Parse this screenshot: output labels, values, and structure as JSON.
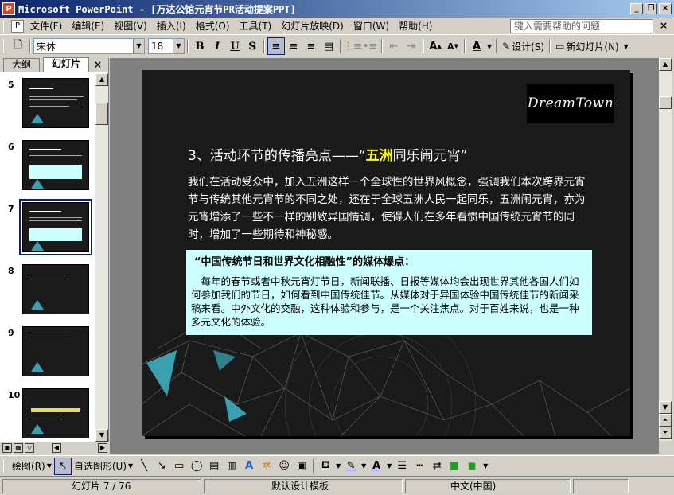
{
  "window": {
    "title": "Microsoft PowerPoint - [万达公馆元宵节PR活动提案PPT]",
    "app_icon": "P"
  },
  "menu": {
    "items": [
      "文件(F)",
      "编辑(E)",
      "视图(V)",
      "插入(I)",
      "格式(O)",
      "工具(T)",
      "幻灯片放映(D)",
      "窗口(W)",
      "帮助(H)"
    ],
    "help_placeholder": "键入需要帮助的问题"
  },
  "toolbar": {
    "font": "宋体",
    "size": "18",
    "bold": "B",
    "italic": "I",
    "underline": "U",
    "shadow": "S",
    "design_label": "设计(S)",
    "new_slide_label": "新幻灯片(N)"
  },
  "outline_panel": {
    "tabs": [
      "大纲",
      "幻灯片"
    ],
    "active_tab": "幻灯片",
    "thumbnails": [
      {
        "num": "5"
      },
      {
        "num": "6"
      },
      {
        "num": "7",
        "selected": true
      },
      {
        "num": "8"
      },
      {
        "num": "9"
      },
      {
        "num": "10"
      }
    ]
  },
  "slide": {
    "logo_text": "DreamTown",
    "heading_prefix": "3、活动环节的传播亮点——“",
    "heading_highlight": "五洲",
    "heading_suffix": "同乐闹元宵”",
    "body": "我们在活动受众中，加入五洲这样一个全球性的世界风概念，强调我们本次跨界元宵节与传统其他元宵节的不同之处，还在于全球五洲人民一起同乐，五洲闹元宵，亦为元宵增添了一些不一样的别致异国情调，使得人们在多年看惯中国传统元宵节的同时，增加了一些期待和神秘感。",
    "box_title": "“中国传统节日和世界文化相融性”的媒体爆点：",
    "box_body": "每年的春节或者中秋元宵灯节日，新闻联播、日报等媒体均会出现世界其他各国人们如何参加我们的节日，如何看到中国传统佳节。从媒体对于异国体验中国传统佳节的新闻采稿来看。中外文化的交融，这种体验和参与，是一个关注焦点。对于百姓来说，也是一种多元文化的体验。"
  },
  "drawing_toolbar": {
    "draw_label": "绘图(R)",
    "autoshape_label": "自选图形(U)"
  },
  "status": {
    "slide_pos": "幻灯片 7 / 76",
    "template": "默认设计模板",
    "language": "中文(中国)"
  },
  "colors": {
    "title_bar_start": "#0a246a",
    "slide_bg": "#1a1a1a",
    "highlight": "#ffff00",
    "box_bg": "#ccffff",
    "accent_triangle": "#3a9fae"
  }
}
